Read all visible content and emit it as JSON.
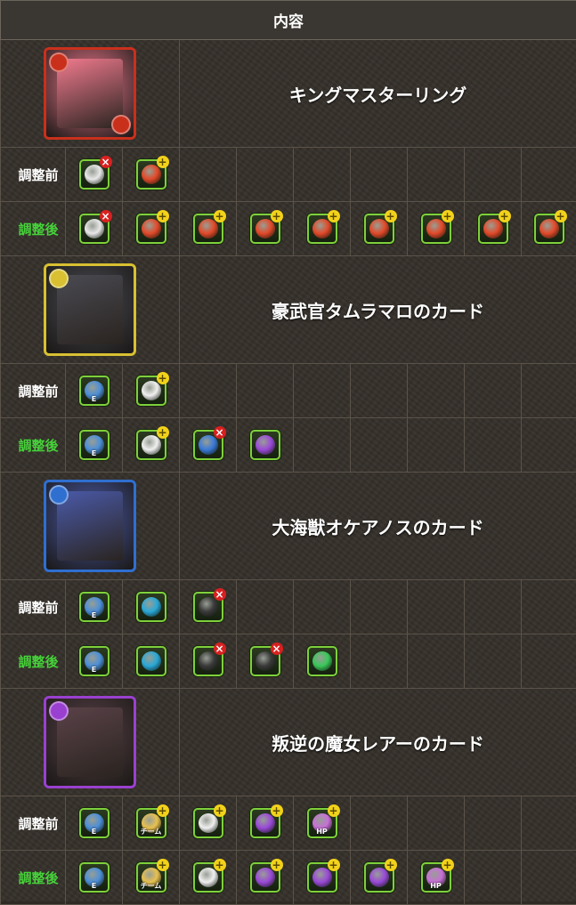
{
  "header": {
    "title": "内容"
  },
  "labels": {
    "before": "調整前",
    "after": "調整後"
  },
  "items": [
    {
      "name": "キングマスターリング",
      "portrait": "pink-king-blob-portrait",
      "frame_color": "#c9301c",
      "art_color": "#f07a8e",
      "before": [
        {
          "icon": "bind-resist-cross-icon",
          "badge": "cross",
          "color": "#e8e8e8"
        },
        {
          "icon": "fire-orb-plus-icon",
          "badge": "plus",
          "color": "#e34a2a"
        }
      ],
      "after": [
        {
          "icon": "bind-resist-cross-icon",
          "badge": "cross",
          "color": "#e8e8e8"
        },
        {
          "icon": "fire-orb-plus-icon",
          "badge": "plus",
          "color": "#e34a2a"
        },
        {
          "icon": "fire-orb-plus-icon",
          "badge": "plus",
          "color": "#e34a2a"
        },
        {
          "icon": "fire-orb-plus-icon",
          "badge": "plus",
          "color": "#e34a2a"
        },
        {
          "icon": "fire-orb-plus-icon",
          "badge": "plus",
          "color": "#e34a2a"
        },
        {
          "icon": "fire-orb-plus-icon",
          "badge": "plus",
          "color": "#e34a2a"
        },
        {
          "icon": "fire-orb-plus-icon",
          "badge": "plus",
          "color": "#e34a2a"
        },
        {
          "icon": "fire-orb-plus-icon",
          "badge": "plus",
          "color": "#e34a2a"
        },
        {
          "icon": "fire-orb-plus-icon",
          "badge": "plus",
          "color": "#e34a2a"
        }
      ]
    },
    {
      "name": "豪武官タムラマロのカード",
      "portrait": "warrior-card-portrait",
      "frame_color": "#d8c032",
      "art_color": "#4a4a52",
      "before": [
        {
          "icon": "skill-boost-icon",
          "badge": "",
          "color": "#4d8fd8",
          "text": "E"
        },
        {
          "icon": "extend-time-plus-icon",
          "badge": "plus",
          "color": "#f0f0f0"
        }
      ],
      "after": [
        {
          "icon": "skill-boost-icon",
          "badge": "",
          "color": "#4d8fd8",
          "text": "E"
        },
        {
          "icon": "extend-time-plus-icon",
          "badge": "plus",
          "color": "#f0f0f0"
        },
        {
          "icon": "skill-bind-resist-icon",
          "badge": "cross",
          "color": "#3a7ad8"
        },
        {
          "icon": "dark-combo-icon",
          "badge": "",
          "color": "#9a4ad8"
        }
      ]
    },
    {
      "name": "大海獣オケアノスのカード",
      "portrait": "sea-beast-card-portrait",
      "frame_color": "#2f6fd0",
      "art_color": "#4a5aa8",
      "before": [
        {
          "icon": "skill-boost-icon",
          "badge": "",
          "color": "#4d8fd8",
          "text": "E"
        },
        {
          "icon": "dual-attack-icon",
          "badge": "",
          "color": "#2aa8d8"
        },
        {
          "icon": "blind-resist-cross-icon",
          "badge": "cross",
          "color": "#3a3a3a"
        }
      ],
      "after": [
        {
          "icon": "skill-boost-icon",
          "badge": "",
          "color": "#4d8fd8",
          "text": "E"
        },
        {
          "icon": "dual-attack-icon",
          "badge": "",
          "color": "#2aa8d8"
        },
        {
          "icon": "blind-resist-cross-icon",
          "badge": "cross",
          "color": "#3a3a3a"
        },
        {
          "icon": "blind-resist-cross-icon",
          "badge": "cross",
          "color": "#3a3a3a"
        },
        {
          "icon": "wood-combo-icon",
          "badge": "",
          "color": "#3ac85a"
        }
      ]
    },
    {
      "name": "叛逆の魔女レアーのカード",
      "portrait": "witch-card-portrait",
      "frame_color": "#9a40d0",
      "art_color": "#5a4248",
      "before": [
        {
          "icon": "skill-boost-icon",
          "badge": "",
          "color": "#4d8fd8",
          "text": "E"
        },
        {
          "icon": "team-boost-plus-icon",
          "badge": "plus",
          "color": "#e8c050",
          "text": "チーム"
        },
        {
          "icon": "extend-time-plus-icon",
          "badge": "plus",
          "color": "#f0f0f0"
        },
        {
          "icon": "dark-orb-plus-icon",
          "badge": "plus",
          "color": "#9a4ad8"
        },
        {
          "icon": "dark-orb-hp-plus-icon",
          "badge": "plus",
          "color": "#c870d8",
          "text": "HP"
        }
      ],
      "after": [
        {
          "icon": "skill-boost-icon",
          "badge": "",
          "color": "#4d8fd8",
          "text": "E"
        },
        {
          "icon": "team-boost-plus-icon",
          "badge": "plus",
          "color": "#e8c050",
          "text": "チーム"
        },
        {
          "icon": "extend-time-plus-icon",
          "badge": "plus",
          "color": "#f0f0f0"
        },
        {
          "icon": "dark-orb-plus-icon",
          "badge": "plus",
          "color": "#9a4ad8"
        },
        {
          "icon": "dark-orb-plus-icon",
          "badge": "plus",
          "color": "#9a4ad8"
        },
        {
          "icon": "dark-orb-plus-icon",
          "badge": "plus",
          "color": "#9a4ad8"
        },
        {
          "icon": "dark-orb-hp-plus-icon",
          "badge": "plus",
          "color": "#c870d8",
          "text": "HP"
        }
      ]
    }
  ]
}
